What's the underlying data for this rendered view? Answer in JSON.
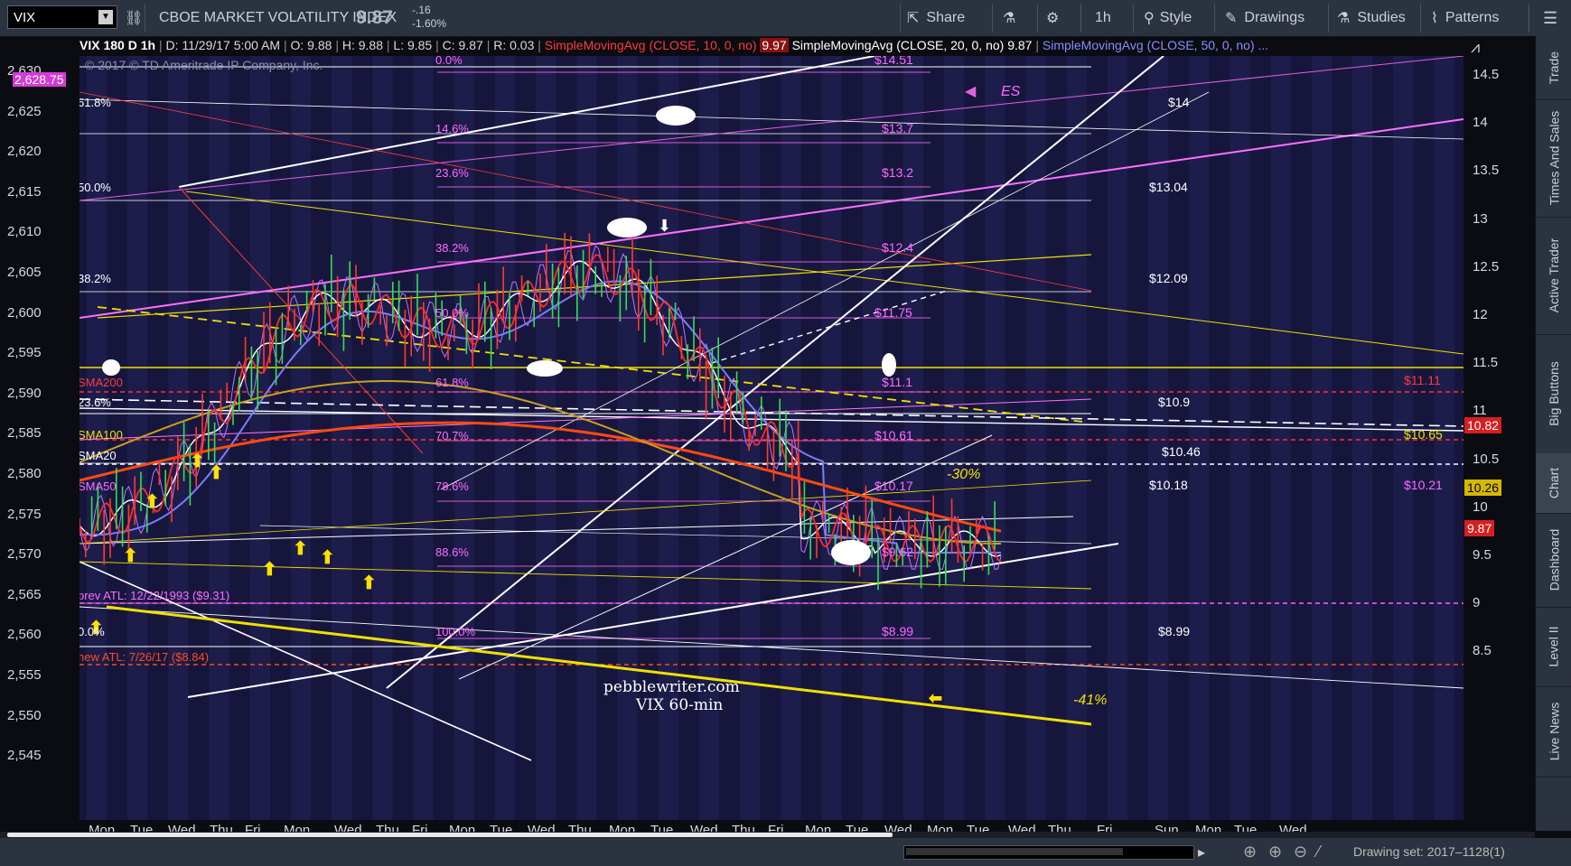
{
  "toolbar": {
    "symbol": "VIX",
    "title": "CBOE MARKET VOLATILITY INDEX",
    "price": "9.87",
    "change": "-.16",
    "change_pct": "-1.60%",
    "share": "Share",
    "interval": "1h",
    "style": "Style",
    "drawings": "Drawings",
    "studies": "Studies",
    "patterns": "Patterns"
  },
  "infobar": {
    "header": "VIX 180 D 1h",
    "date": "D: 11/29/17 5:00 AM",
    "open": "O: 9.88",
    "high": "H: 9.88",
    "low": "L: 9.85",
    "close": "C: 9.87",
    "range": "R: 0.03",
    "sma10": "SimpleMovingAvg (CLOSE, 10, 0, no)",
    "sma10_val": "9.97",
    "sma20": "SimpleMovingAvg (CLOSE, 20, 0, no)",
    "sma20_val": "9.87",
    "sma50": "SimpleMovingAvg (CLOSE, 50, 0, no) ..."
  },
  "copyright": "© 2017 © TD Ameritrade IP Company, Inc.",
  "left_axis": {
    "ticks": [
      "2,630",
      "2,625",
      "2,620",
      "2,615",
      "2,610",
      "2,605",
      "2,600",
      "2,595",
      "2,590",
      "2,585",
      "2,580",
      "2,575",
      "2,570",
      "2,565",
      "2,560",
      "2,555",
      "2,550",
      "2,545"
    ],
    "highlight": "2,628.75"
  },
  "right_axis": {
    "ticks": [
      "14.5",
      "14",
      "13.5",
      "13",
      "12.5",
      "12",
      "11.5",
      "11",
      "10.5",
      "10",
      "9.5",
      "9",
      "8.5"
    ],
    "tag_1082": "10.82",
    "tag_1026": "10.26",
    "tag_987": "9.87"
  },
  "x_axis": [
    "Mon",
    "Tue",
    "Wed",
    "Thu",
    "Fri",
    "Mon",
    "Wed",
    "Thu",
    "Fri",
    "Mon",
    "Tue",
    "Wed",
    "Thu",
    "Mon",
    "Tue",
    "Wed",
    "Thu",
    "Fri",
    "Mon",
    "Tue",
    "Wed",
    "Mon",
    "Tue",
    "Wed",
    "Thu",
    "Fri",
    "Sun",
    "Mon",
    "Tue",
    "Wed"
  ],
  "fib_left": [
    "61.8%",
    "50.0%",
    "38.2%",
    "23.6%",
    "0.0%"
  ],
  "fib_mid": [
    "0.0%",
    "14.6%",
    "23.6%",
    "38.2%",
    "50.0%",
    "61.8%",
    "70.7%",
    "78.6%",
    "88.6%",
    "100.0%"
  ],
  "fib_prices": [
    "$14.51",
    "$13.7",
    "$13.2",
    "$12.4",
    "$11.75",
    "$11.1",
    "$10.61",
    "$10.17",
    "$9.62",
    "$8.99"
  ],
  "level_labels": [
    "$14",
    "$13.04",
    "$12.09",
    "$10.9",
    "$10.46",
    "$10.18",
    "$8.99"
  ],
  "right_labels": [
    "$11.11",
    "$10.65",
    "$10.21"
  ],
  "sma_labels": [
    "SMA200",
    "SMA100",
    "SMA20",
    "SMA50"
  ],
  "atl": {
    "prev": "prev ATL: 12/22/1993 ($9.31)",
    "new": "new ATL: 7/26/17 ($8.84)"
  },
  "annotations": {
    "site": "pebblewriter.com",
    "chart": "VIX 60-min",
    "pct30": "-30%",
    "pct41": "-41%",
    "es": "ES"
  },
  "side_tabs": [
    "Trade",
    "Times And Sales",
    "Active Trader",
    "Big Buttons",
    "Chart",
    "Dashboard",
    "Level II",
    "Live News"
  ],
  "bottom": {
    "drawing_set": "Drawing set: 2017–1128(1)"
  }
}
